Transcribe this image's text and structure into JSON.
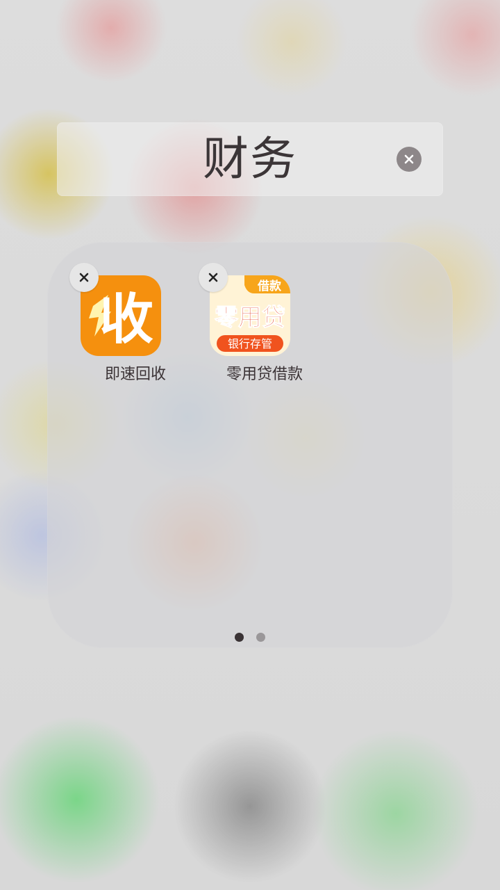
{
  "folder": {
    "title": "财务",
    "apps": [
      {
        "label": "即速回收",
        "icon_text": "收",
        "icon_name": "jisu-recycle-app-icon",
        "icon_color": "#f5900e"
      },
      {
        "label": "零用贷借款",
        "icon_text": "零用贷",
        "icon_tag": "借款",
        "icon_banner": "银行存管",
        "icon_name": "lingyongdai-loan-app-icon",
        "icon_color": "#f7a51b"
      }
    ]
  },
  "pagination": {
    "current_page": 1,
    "total_pages": 2
  },
  "colors": {
    "dark_text": "#3b3537",
    "orange": "#f5900e",
    "loan_red": "#e43a1c"
  }
}
